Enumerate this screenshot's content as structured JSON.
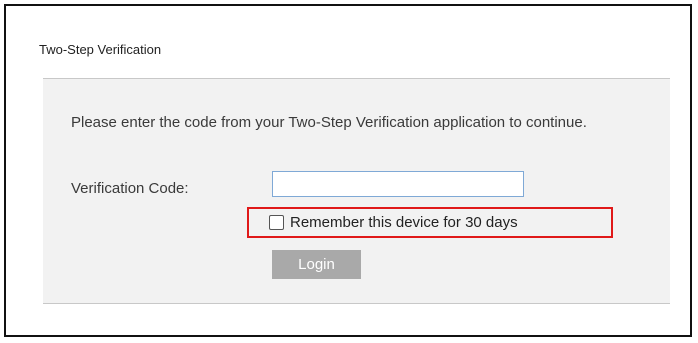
{
  "dialog": {
    "title": "Two-Step Verification",
    "instructions": "Please enter the code from your Two-Step Verification application to continue.",
    "code_field": {
      "label": "Verification Code:",
      "value": "",
      "placeholder": ""
    },
    "remember": {
      "label": "Remember this device for 30 days",
      "checked": false,
      "highlight_color": "#e01919"
    },
    "login_button": {
      "label": "Login",
      "color": "#a9a9a9"
    }
  }
}
